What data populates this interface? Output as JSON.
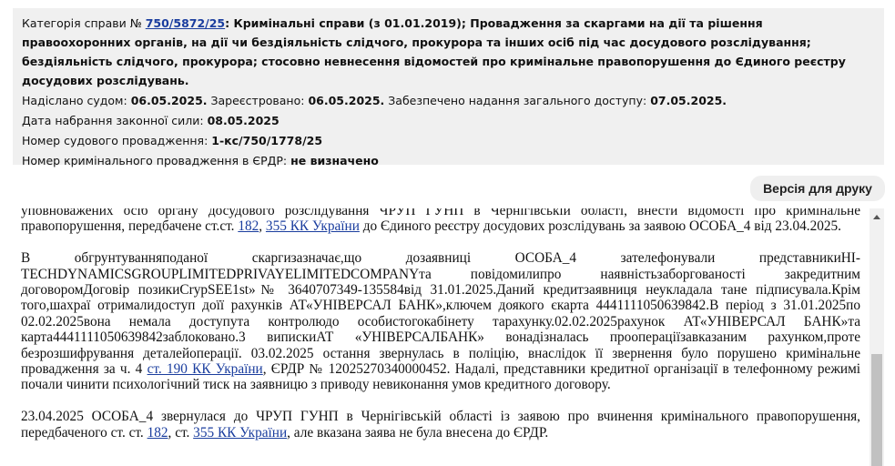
{
  "case": {
    "category_label": "Категорія справи №",
    "case_number": "750/5872/25",
    "category_text": ": Кримінальні справи (з 01.01.2019); Провадження за скаргами на дії та рішення правоохоронних органів, на дії чи бездіяльність слідчого, прокурора та інших осіб під час досудового розслідування; бездіяльність слідчого, прокурора; стосовно невнесення відомостей про кримінальне правопорушення до Єдиного реєстру досудових розслідувань.",
    "sent_label": "Надіслано судом:",
    "sent_value": "06.05.2025.",
    "registered_label": "Зареєстровано:",
    "registered_value": "06.05.2025.",
    "access_label": "Забезпечено надання загального доступу:",
    "access_value": "07.05.2025.",
    "effective_label": "Дата набрання законної сили:",
    "effective_value": "08.05.2025",
    "court_no_label": "Номер судового провадження:",
    "court_no_value": "1-кс/750/1778/25",
    "erdr_label": "Номер кримінального провадження в ЄРДР:",
    "erdr_value": "не визначено"
  },
  "toolbar": {
    "print_label": "Версія для друку"
  },
  "document": {
    "p1": {
      "t1": "уповноважених осіб органу досудового розслідування ЧРУП ГУНП в Чернігівській області, внести відомості про кримінальне правопорушення, передбачене ст.ст.",
      "link1": "182",
      "t2": ",",
      "link2": "355 КК України",
      "t3": "до Єдиного реєстру досудових розслідувань за заявою ОСОБА_4 від 23.04.2025."
    },
    "p2": {
      "t1": "В обгрунтуванняподаної скаргизазначає,що дозаявниці ОСОБА_4 зателефонували представникиHI-TECHDYNAMICSGROUPLIMITEDPRIVAYELIMITEDCOMPANYта повідомилипро наявністьзаборгованості закредитним договоромДоговір позикиCrypSEE1st»№ 3640707349-135584від 31.01.2025.Даний кредитзаявниця неукладала тане підписувала.Крім того,шахраї отрималидоступ доїї рахунків АТ«УНІВЕРСАЛ БАНК»,ключем доякого єкарта 4441111050639842.В період з 31.01.2025по 02.02.2025вона немала доступута контролюдо особистогокабінету тарахунку.02.02.2025рахунок АТ«УНІВЕРСАЛ БАНК»та карта4441111050639842заблоковано.3 випискиАТ «УНІВЕРСАЛБАНК» вонадізналась проопераціїзавказаним рахунком,проте безрозшифрування деталейоперації. 03.02.2025 остання звернулась в поліцію, внаслідок її звернення було порушено кримінальне провадження за ч. 4",
      "link1": "ст. 190 КК України",
      "t2": ", ЄРДР № 12025270340000452. Надалі, представники кредитної організації в телефонному режимі почали чинити психологічний тиск на заявницю з приводу невиконання умов кредитного договору."
    },
    "p3": {
      "t1": "23.04.2025 ОСОБА_4 звернулася до ЧРУП ГУНП в Чернігівській області із заявою про вчинення кримінального правопорушення, передбаченого ст. ст.",
      "link1": "182",
      "t2": ", ст.",
      "link2": "355 КК України",
      "t3": ", але вказана заява не була внесена до ЄРДР."
    }
  }
}
